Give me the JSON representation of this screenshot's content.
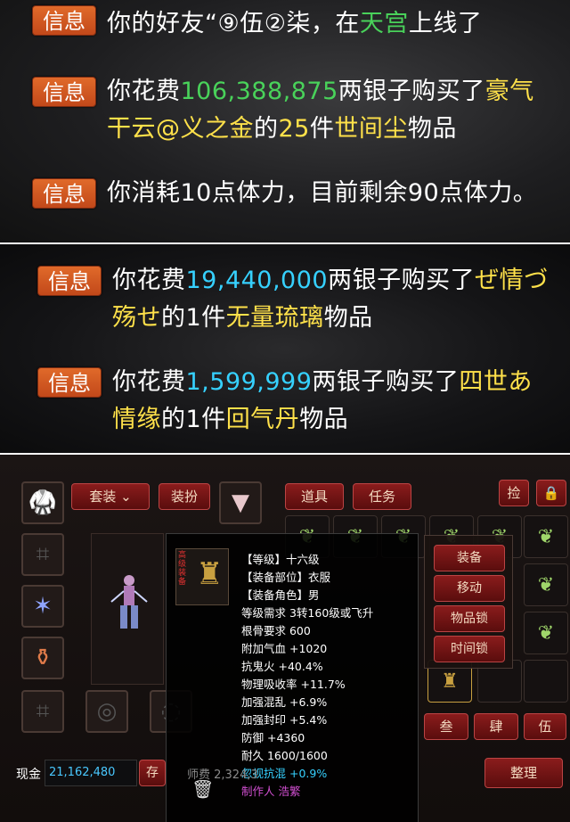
{
  "panel1": {
    "messages": [
      {
        "tag": "信息",
        "parts": [
          {
            "t": "你的好友“⑨伍②柒，在",
            "c": "w"
          },
          {
            "t": "天宫",
            "c": "g"
          },
          {
            "t": "上线了",
            "c": "w"
          }
        ]
      },
      {
        "tag": "信息",
        "parts": [
          {
            "t": "你花费",
            "c": "w"
          },
          {
            "t": "106,388,875",
            "c": "g"
          },
          {
            "t": "两银子购买了",
            "c": "w"
          },
          {
            "t": "豪气",
            "c": "y"
          }
        ],
        "line2": [
          {
            "t": "干云@义之金",
            "c": "y"
          },
          {
            "t": "的",
            "c": "w"
          },
          {
            "t": "25",
            "c": "y"
          },
          {
            "t": "件",
            "c": "w"
          },
          {
            "t": "世间尘",
            "c": "y"
          },
          {
            "t": "物品",
            "c": "w"
          }
        ]
      },
      {
        "tag": "信息",
        "parts": [
          {
            "t": "你消耗10点体力，目前剩余90点体力。",
            "c": "w"
          }
        ]
      }
    ]
  },
  "panel2": {
    "messages": [
      {
        "tag": "信息",
        "parts": [
          {
            "t": "你花费",
            "c": "w"
          },
          {
            "t": "19,440,000",
            "c": "c"
          },
          {
            "t": "两银子购买了",
            "c": "w"
          },
          {
            "t": "ぜ情づ",
            "c": "y"
          }
        ],
        "line2": [
          {
            "t": "殇せ",
            "c": "y"
          },
          {
            "t": "的1件",
            "c": "w"
          },
          {
            "t": "无量琉璃",
            "c": "y"
          },
          {
            "t": "物品",
            "c": "w"
          }
        ]
      },
      {
        "tag": "信息",
        "parts": [
          {
            "t": "你花费",
            "c": "w"
          },
          {
            "t": "1,599,999",
            "c": "c"
          },
          {
            "t": "两银子购买了",
            "c": "w"
          },
          {
            "t": "四世あ",
            "c": "y"
          }
        ],
        "line2": [
          {
            "t": "情缘",
            "c": "y"
          },
          {
            "t": "的1件",
            "c": "w"
          },
          {
            "t": "回气丹",
            "c": "y"
          },
          {
            "t": "物品",
            "c": "w"
          }
        ]
      }
    ]
  },
  "inventory": {
    "tabs": {
      "suit": "套装 ⌄",
      "dress": "装扮",
      "items": "道具",
      "tasks": "任务",
      "pick": "捡",
      "lock": "🔒"
    },
    "tooltip": {
      "emblem": "高级装备",
      "lines": [
        "【等级】十六级",
        "【装备部位】衣服",
        "【装备角色】男",
        "等级需求 3转160级或飞升",
        "根骨要求 600",
        "附加气血 +1020",
        "抗鬼火 +40.4%",
        "物理吸收率 +11.7%",
        "加强混乱 +6.9%",
        "加强封印 +5.4%",
        "防御 +4360",
        "耐久 1600/1600",
        "忽视抗混 +0.9%",
        "制作人 浩繁"
      ]
    },
    "context_menu": [
      "装备",
      "移动",
      "物品锁",
      "时间锁"
    ],
    "pages": [
      "叁",
      "肆",
      "伍"
    ],
    "cash_label": "现金",
    "cash_value": "21,162,480",
    "deposit": "存",
    "master_fee": "师费 2,324,3",
    "sort": "整理",
    "colors": {
      "green": "#49d25a",
      "yellow": "#ffe14a",
      "cyan": "#36d1ff",
      "tag": "#d55a22"
    }
  }
}
